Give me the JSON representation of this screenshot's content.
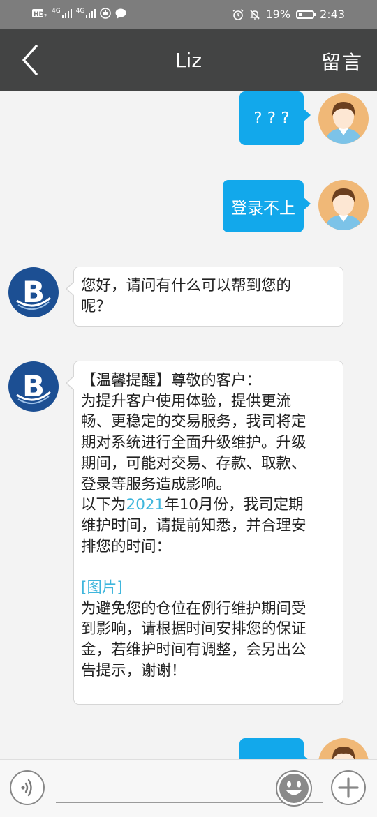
{
  "status_bar": {
    "battery": "19%",
    "time": "2:43",
    "left_icons": [
      "hd-icon",
      "4g-signal-icon",
      "4g-signal-icon",
      "hotspot-icon",
      "message-icon"
    ],
    "right_icons": [
      "alarm-icon",
      "mute-icon",
      "battery-icon"
    ]
  },
  "header": {
    "title": "Liz",
    "leave_message_label": "留言",
    "back_icon": "chevron-left-icon"
  },
  "messages": [
    {
      "from": "user",
      "text": "? ? ?"
    },
    {
      "from": "user",
      "text": "登录不上"
    },
    {
      "from": "bot",
      "lines": [
        "您好，请问有什么可以帮到您的",
        "呢？"
      ]
    },
    {
      "from": "bot",
      "lines": [
        "【温馨提醒】尊敬的客户：",
        "为提升客户使用体验，提供更流",
        "畅、更稳定的交易服务，我司将定",
        "期对系统进行全面升级维护。升级",
        "期间，可能对交易、存款、取款、",
        "登录等服务造成影响。",
        "以下为",
        "2021",
        "年10月份，我司定期",
        "维护时间，请提前知悉，并合理安",
        "排您的时间：",
        "",
        "[图片]",
        "为避免您的仓位在例行维护期间受",
        "到影响，请根据时间安排您的保证",
        "金，若维护时间有调整，会另出公",
        "告提示，谢谢！"
      ]
    },
    {
      "from": "user",
      "text": "..."
    }
  ],
  "input_bar": {
    "placeholder": "",
    "icons": [
      "voice-icon",
      "emoji-icon",
      "plus-icon"
    ]
  },
  "colors": {
    "header_bg": "#434444",
    "status_bg": "#7d7d7d",
    "outgoing_bubble": "#12a8eb",
    "link_blue": "#3fb6dc",
    "bot_logo": "#1c4f93"
  }
}
